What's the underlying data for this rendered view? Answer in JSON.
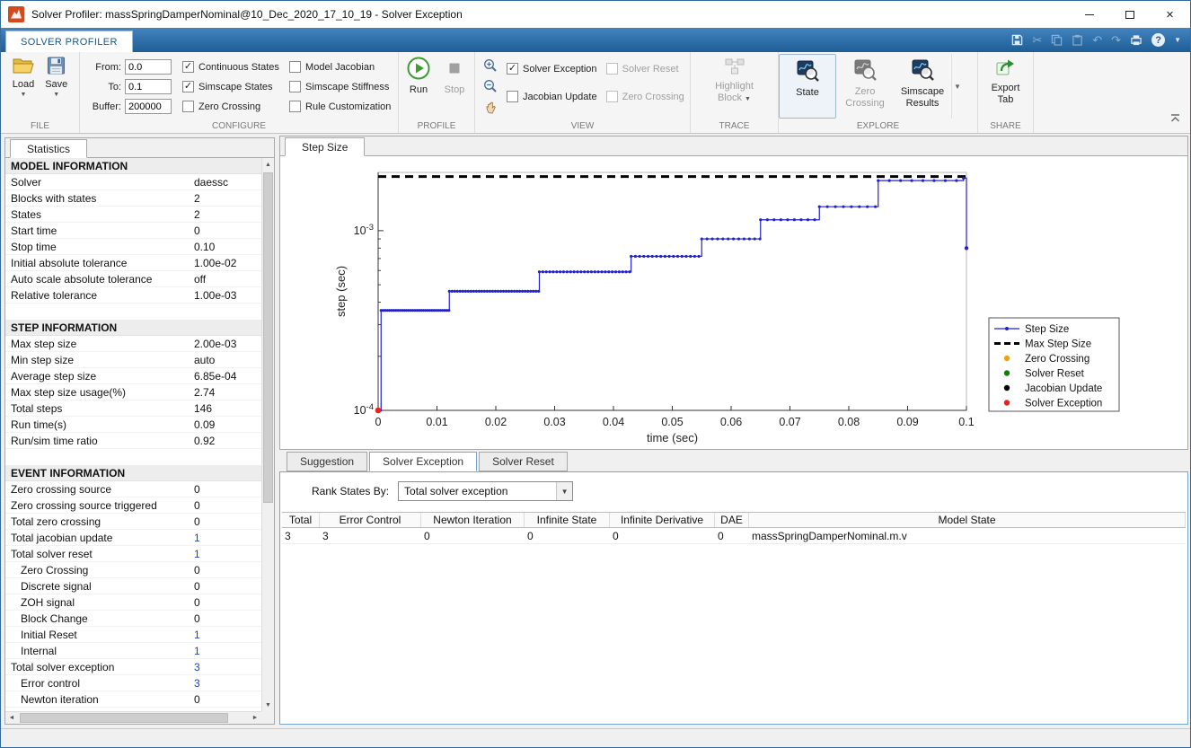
{
  "window": {
    "title": "Solver Profiler: massSpringDamperNominal@10_Dec_2020_17_10_19 - Solver Exception"
  },
  "quick_access": {
    "icons": [
      "save-icon",
      "cut-icon",
      "copy-icon",
      "paste-icon",
      "undo-icon",
      "redo-icon",
      "print-icon",
      "help-icon",
      "chevron-down-icon"
    ]
  },
  "ribbon": {
    "tab_label": "SOLVER PROFILER",
    "file": {
      "label": "FILE",
      "load": "Load",
      "save": "Save"
    },
    "configure": {
      "label": "CONFIGURE",
      "from_label": "From:",
      "from_value": "0.0",
      "to_label": "To:",
      "to_value": "0.1",
      "buffer_label": "Buffer:",
      "buffer_value": "200000",
      "checks_col1": [
        {
          "label": "Continuous States",
          "checked": true,
          "enabled": true
        },
        {
          "label": "Simscape States",
          "checked": true,
          "enabled": true
        },
        {
          "label": "Zero Crossing",
          "checked": false,
          "enabled": true
        }
      ],
      "checks_col2": [
        {
          "label": "Model Jacobian",
          "checked": false,
          "enabled": true
        },
        {
          "label": "Simscape Stiffness",
          "checked": false,
          "enabled": true
        },
        {
          "label": "Rule Customization",
          "checked": false,
          "enabled": true
        }
      ]
    },
    "profile": {
      "label": "PROFILE",
      "run": "Run",
      "stop": "Stop"
    },
    "view": {
      "label": "VIEW",
      "checks_col1": [
        {
          "label": "Solver Exception",
          "checked": true,
          "enabled": true
        },
        {
          "label": "Jacobian Update",
          "checked": false,
          "enabled": true
        }
      ],
      "checks_col2": [
        {
          "label": "Solver Reset",
          "checked": false,
          "enabled": false
        },
        {
          "label": "Zero Crossing",
          "checked": false,
          "enabled": false
        }
      ]
    },
    "trace": {
      "label": "TRACE",
      "button": "Highlight Block"
    },
    "explore": {
      "label": "EXPLORE",
      "buttons": [
        {
          "label": "State",
          "enabled": true,
          "selected": true
        },
        {
          "label": "Zero Crossing",
          "enabled": false,
          "selected": false
        },
        {
          "label": "Simscape Results",
          "enabled": true,
          "selected": false
        }
      ]
    },
    "share": {
      "label": "SHARE",
      "button": "Export Tab"
    }
  },
  "statistics": {
    "tab_label": "Statistics",
    "rows": [
      {
        "type": "header",
        "label": "MODEL INFORMATION"
      },
      {
        "label": "Solver",
        "value": "daessc"
      },
      {
        "label": "Blocks with states",
        "value": "2"
      },
      {
        "label": "States",
        "value": "2"
      },
      {
        "label": "Start time",
        "value": "0"
      },
      {
        "label": "Stop time",
        "value": "0.10"
      },
      {
        "label": "Initial absolute tolerance",
        "value": "1.00e-02"
      },
      {
        "label": "Auto scale absolute tolerance",
        "value": "off"
      },
      {
        "label": "Relative tolerance",
        "value": "1.00e-03"
      },
      {
        "type": "blank"
      },
      {
        "type": "header",
        "label": "STEP INFORMATION"
      },
      {
        "label": "Max step size",
        "value": "2.00e-03"
      },
      {
        "label": "Min step size",
        "value": "auto"
      },
      {
        "label": "Average step size",
        "value": "6.85e-04"
      },
      {
        "label": "Max step size usage(%)",
        "value": "2.74"
      },
      {
        "label": "Total steps",
        "value": "146"
      },
      {
        "label": "Run time(s)",
        "value": "0.09"
      },
      {
        "label": "Run/sim time ratio",
        "value": "0.92"
      },
      {
        "type": "blank"
      },
      {
        "type": "header",
        "label": "EVENT INFORMATION"
      },
      {
        "label": "Zero crossing source",
        "value": "0"
      },
      {
        "label": "Zero crossing source triggered",
        "value": "0"
      },
      {
        "label": "Total zero crossing",
        "value": "0"
      },
      {
        "label": "Total jacobian update",
        "value": "1",
        "link": true
      },
      {
        "label": "Total solver reset",
        "value": "1",
        "link": true
      },
      {
        "label": "Zero Crossing",
        "value": "0",
        "indent": true
      },
      {
        "label": "Discrete signal",
        "value": "0",
        "indent": true
      },
      {
        "label": "ZOH signal",
        "value": "0",
        "indent": true
      },
      {
        "label": "Block Change",
        "value": "0",
        "indent": true
      },
      {
        "label": "Initial Reset",
        "value": "1",
        "indent": true,
        "link": true
      },
      {
        "label": "Internal",
        "value": "1",
        "indent": true,
        "link": true
      },
      {
        "label": "Total solver exception",
        "value": "3",
        "link": true
      },
      {
        "label": "Error control",
        "value": "3",
        "indent": true,
        "link": true
      },
      {
        "label": "Newton iteration",
        "value": "0",
        "indent": true
      }
    ]
  },
  "chart_data": {
    "type": "line",
    "tab_label": "Step Size",
    "title": "",
    "xlabel": "time (sec)",
    "ylabel": "step (sec)",
    "xlim": [
      0,
      0.1
    ],
    "ylim": [
      0.0001,
      0.00211
    ],
    "y_scale": "log",
    "x_ticks": [
      0,
      0.01,
      0.02,
      0.03,
      0.04,
      0.05,
      0.06,
      0.07,
      0.08,
      0.09,
      0.1
    ],
    "x_tick_labels": [
      "0",
      "0.01",
      "0.02",
      "0.03",
      "0.04",
      "0.05",
      "0.06",
      "0.07",
      "0.08",
      "0.09",
      "0.1"
    ],
    "y_major_ticks": [
      0.001,
      0.0001
    ],
    "y_tick_labels": [
      "10^-3",
      "10^-4"
    ],
    "grid": false,
    "series": [
      {
        "name": "Step Size",
        "color": "#2222cc",
        "marker": "dot",
        "step_points": [
          [
            0,
            0.0001
          ],
          [
            0.0005,
            0.00036
          ],
          [
            0.0121,
            0.00046
          ],
          [
            0.0274,
            0.00059
          ],
          [
            0.043,
            0.00072
          ],
          [
            0.055,
            0.0009
          ],
          [
            0.065,
            0.00115
          ],
          [
            0.075,
            0.00136
          ],
          [
            0.085,
            0.0019
          ],
          [
            0.0995,
            0.00196
          ],
          [
            0.1,
            0.0008
          ]
        ]
      },
      {
        "name": "Max Step Size",
        "color": "#000000",
        "dashed": true,
        "points": [
          [
            0,
            0.002
          ],
          [
            0.1,
            0.002
          ]
        ]
      }
    ],
    "event_markers": [
      {
        "name": "Solver Exception",
        "color": "#e8221f",
        "t": 0,
        "value": 0.0001
      }
    ],
    "legend_position": "right",
    "legend": [
      {
        "label": "Step Size",
        "swatch": "line-dot",
        "color": "#2222cc"
      },
      {
        "label": "Max Step Size",
        "swatch": "dash",
        "color": "#000000"
      },
      {
        "label": "Zero Crossing",
        "swatch": "dot",
        "color": "#f0a30a"
      },
      {
        "label": "Solver Reset",
        "swatch": "dot",
        "color": "#0c800c"
      },
      {
        "label": "Jacobian Update",
        "swatch": "dot",
        "color": "#000000"
      },
      {
        "label": "Solver Exception",
        "swatch": "dot",
        "color": "#e8221f"
      }
    ]
  },
  "bottom_panel": {
    "tabs": [
      {
        "label": "Suggestion",
        "active": false
      },
      {
        "label": "Solver Exception",
        "active": true
      },
      {
        "label": "Solver Reset",
        "active": false
      }
    ],
    "rank_label": "Rank States By:",
    "rank_value": "Total solver exception",
    "table": {
      "headers": [
        "Total",
        "Error Control",
        "Newton Iteration",
        "Infinite State",
        "Infinite Derivative",
        "DAE",
        "Model State"
      ],
      "rows": [
        [
          "3",
          "3",
          "0",
          "0",
          "0",
          "0",
          "massSpringDamperNominal.m.v"
        ]
      ]
    }
  }
}
